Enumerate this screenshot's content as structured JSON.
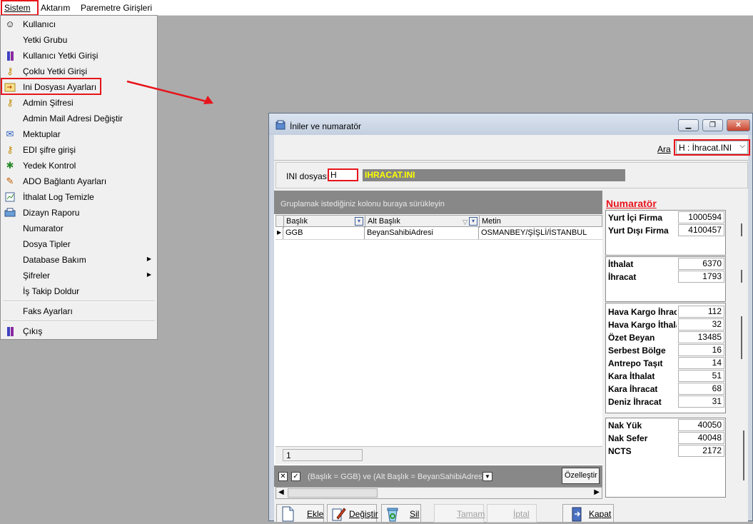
{
  "menubar": {
    "items": [
      "Sistem",
      "Aktarım",
      "Paremetre Girişleri"
    ]
  },
  "sistem_menu": {
    "items": [
      {
        "label": "Kullanıcı",
        "icon": "user-icon"
      },
      {
        "label": "Yetki Grubu",
        "icon": ""
      },
      {
        "label": "Kullanıcı Yetki Girişi",
        "icon": "user-key-icon"
      },
      {
        "label": "Çoklu Yetki Girişi",
        "icon": "keys-icon"
      },
      {
        "label": "Ini Dosyası  Ayarları",
        "icon": "ini-settings-icon"
      },
      {
        "label": "Admin Şifresi",
        "icon": "key-icon"
      },
      {
        "label": "Admin Mail Adresi Değiştir",
        "icon": ""
      },
      {
        "label": "Mektuplar",
        "icon": "letters-icon"
      },
      {
        "label": "EDI şifre girişi",
        "icon": "keys-icon"
      },
      {
        "label": "Yedek Kontrol",
        "icon": "backup-icon"
      },
      {
        "label": "ADO Bağlantı Ayarları",
        "icon": "connection-icon"
      },
      {
        "label": "İthalat Log Temizle",
        "icon": "log-icon"
      },
      {
        "label": "Dizayn Raporu",
        "icon": "report-icon"
      },
      {
        "label": "Numarator",
        "icon": ""
      },
      {
        "label": "Dosya Tipler",
        "icon": ""
      },
      {
        "label": "Database Bakım",
        "icon": "",
        "submenu": true
      },
      {
        "label": "Şifreler",
        "icon": "",
        "submenu": true
      },
      {
        "label": "İş Takip Doldur",
        "icon": ""
      }
    ],
    "faks": "Faks Ayarları",
    "cikis": "Çıkış"
  },
  "window": {
    "title": "İniler ve numaratör",
    "search_label": "Ara",
    "search_value": "H : İhracat.INI",
    "ini_label": "INI dosyası",
    "ini_value": "H",
    "ini_name": "IHRACAT.INI",
    "group_hint": "Gruplamak istediğiniz kolonu buraya sürükleyin",
    "columns": [
      "Başlık",
      "Alt Başlık",
      "Metin"
    ],
    "rows": [
      {
        "baslik": "GGB",
        "alt_baslik": "BeyanSahibiAdresi",
        "metin": "OSMANBEY/ŞİŞLİ/İSTANBUL"
      }
    ],
    "footer_count": "1",
    "filter_text": "(Başlık = GGB) ve (Alt Başlık = BeyanSahibiAdresi)",
    "customize_label": "Özelleştir",
    "buttons": {
      "ekle": "Ekle",
      "degistir": "Değiştir",
      "sil": "Sil",
      "tamam": "Tamam",
      "iptal": "İptal",
      "kapat": "Kapat"
    }
  },
  "numarator": {
    "title": "Numaratör",
    "groups": [
      [
        {
          "label": "Yurt İçi Firma",
          "value": "1000594"
        },
        {
          "label": "Yurt Dışı Firma",
          "value": "4100457"
        }
      ],
      [
        {
          "label": "İthalat",
          "value": "6370"
        },
        {
          "label": "İhracat",
          "value": "1793"
        }
      ],
      [
        {
          "label": "Hava Kargo İhracat",
          "value": "112"
        },
        {
          "label": "Hava Kargo İthalat",
          "value": "32"
        },
        {
          "label": "Özet Beyan",
          "value": "13485"
        },
        {
          "label": "Serbest Bölge",
          "value": "16"
        },
        {
          "label": "Antrepo Taşıt",
          "value": "14"
        },
        {
          "label": "Kara İthalat",
          "value": "51"
        },
        {
          "label": "Kara İhracat",
          "value": "68"
        },
        {
          "label": "Deniz İhracat",
          "value": "31"
        }
      ],
      [
        {
          "label": "Nak Yük",
          "value": "40050"
        },
        {
          "label": "Nak Sefer",
          "value": "40048"
        },
        {
          "label": "NCTS",
          "value": "2172"
        }
      ]
    ]
  },
  "colors": {
    "highlight": "#e8141b",
    "ini_name_text": "#ffff00",
    "numarator_title": "#e8141b"
  }
}
